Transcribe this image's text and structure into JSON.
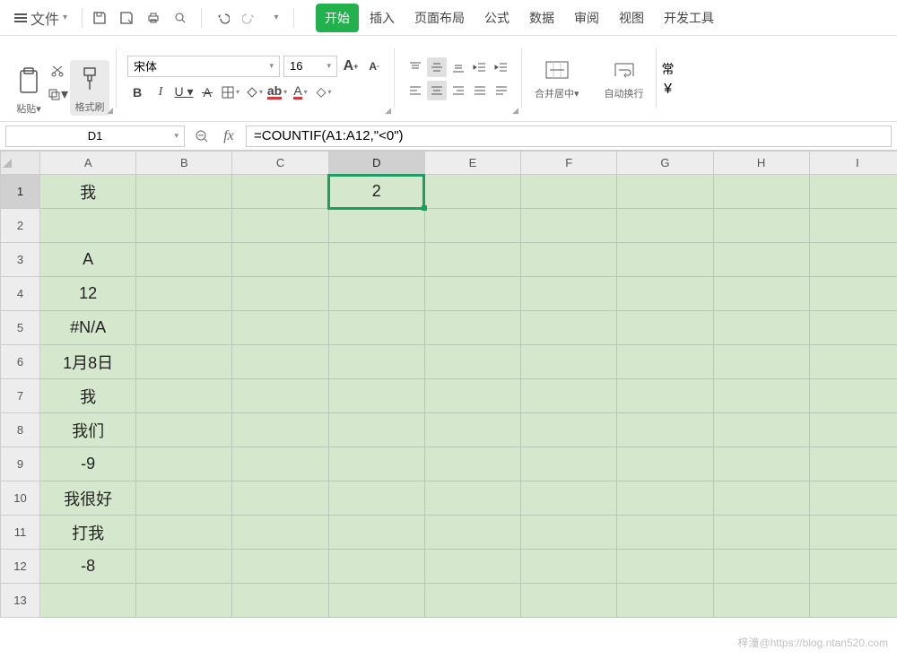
{
  "menu": {
    "file": "文件",
    "tabs": [
      "开始",
      "插入",
      "页面布局",
      "公式",
      "数据",
      "审阅",
      "视图",
      "开发工具"
    ],
    "active_tab_index": 0
  },
  "ribbon": {
    "paste": "粘贴",
    "brush": "格式刷",
    "font_name": "宋体",
    "font_size": "16",
    "merge": "合并居中",
    "wrap": "自动换行",
    "normal": "常"
  },
  "formula_bar": {
    "namebox": "D1",
    "formula": "=COUNTIF(A1:A12,\"<0\")"
  },
  "grid": {
    "columns": [
      "A",
      "B",
      "C",
      "D",
      "E",
      "F",
      "G",
      "H",
      "I"
    ],
    "rows": 13,
    "selected_cell": {
      "col": "D",
      "row": 1
    },
    "cells": {
      "A1": "我",
      "D1": "2",
      "A3": "A",
      "A4": "12",
      "A5": "#N/A",
      "A6": "1月8日",
      "A7": "我",
      "A8": "我们",
      "A9": "-9",
      "A10": "我很好",
      "A11": "打我",
      "A12": "-8"
    }
  },
  "watermark": "梓潼@https://blog.ntan520.com"
}
